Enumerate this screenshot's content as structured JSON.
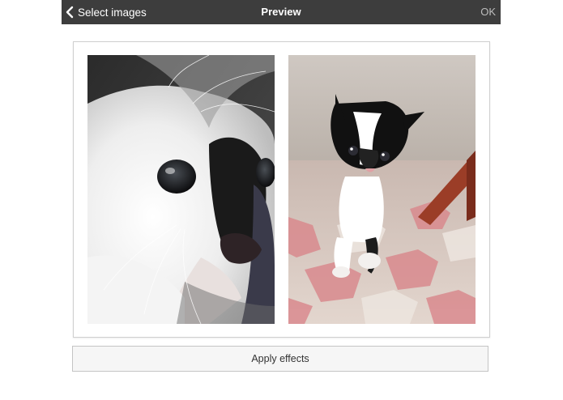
{
  "navbar": {
    "back_label": "Select images",
    "back_icon": "chevron-left-icon",
    "title": "Preview",
    "ok_label": "OK",
    "background_color": "#3d3d3d"
  },
  "preview": {
    "images": [
      {
        "subject": "Close-up of a white and grey kitten's face"
      },
      {
        "subject": "Black and white kitten standing on a tiled floor"
      }
    ]
  },
  "actions": {
    "apply_label": "Apply effects"
  }
}
